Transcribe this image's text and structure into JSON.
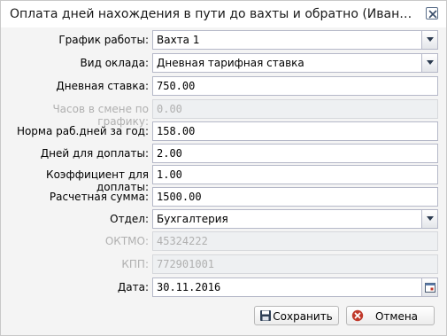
{
  "window": {
    "title": "Оплата дней нахождения в пути до вахты и обратно (Иванов Петр Сергеевич)"
  },
  "form": {
    "schedule": {
      "label": "График работы:",
      "value": "Вахта 1"
    },
    "salary_type": {
      "label": "Вид оклада:",
      "value": "Дневная тарифная ставка"
    },
    "daily_rate": {
      "label": "Дневная ставка:",
      "value": "750.00"
    },
    "shift_hours": {
      "label": "Часов в смене по графику:",
      "value": "0.00"
    },
    "workdays_norm": {
      "label": "Норма раб.дней за год:",
      "value": "158.00"
    },
    "extra_days": {
      "label": "Дней для доплаты:",
      "value": "2.00"
    },
    "extra_coeff": {
      "label": "Коэффициент для доплаты:",
      "value": "1.00"
    },
    "calc_sum": {
      "label": "Расчетная сумма:",
      "value": "1500.00"
    },
    "department": {
      "label": "Отдел:",
      "value": "Бухгалтерия"
    },
    "oktmo": {
      "label": "ОКТМО:",
      "value": "45324222"
    },
    "kpp": {
      "label": "КПП:",
      "value": "772901001"
    },
    "date": {
      "label": "Дата:",
      "value": "30.11.2016"
    }
  },
  "buttons": {
    "save_label": "Сохранить",
    "cancel_label": "Отмена"
  },
  "icons": {
    "close": "close-icon",
    "dropdown": "chevron-down-icon",
    "calendar": "calendar-icon",
    "save": "floppy-disk-icon",
    "cancel": "cancel-icon"
  },
  "colors": {
    "window_bg": "#f4f4f4",
    "field_border": "#b5b8c8",
    "disabled_text": "#b0b0b0",
    "cancel_icon": "#c0392b"
  }
}
